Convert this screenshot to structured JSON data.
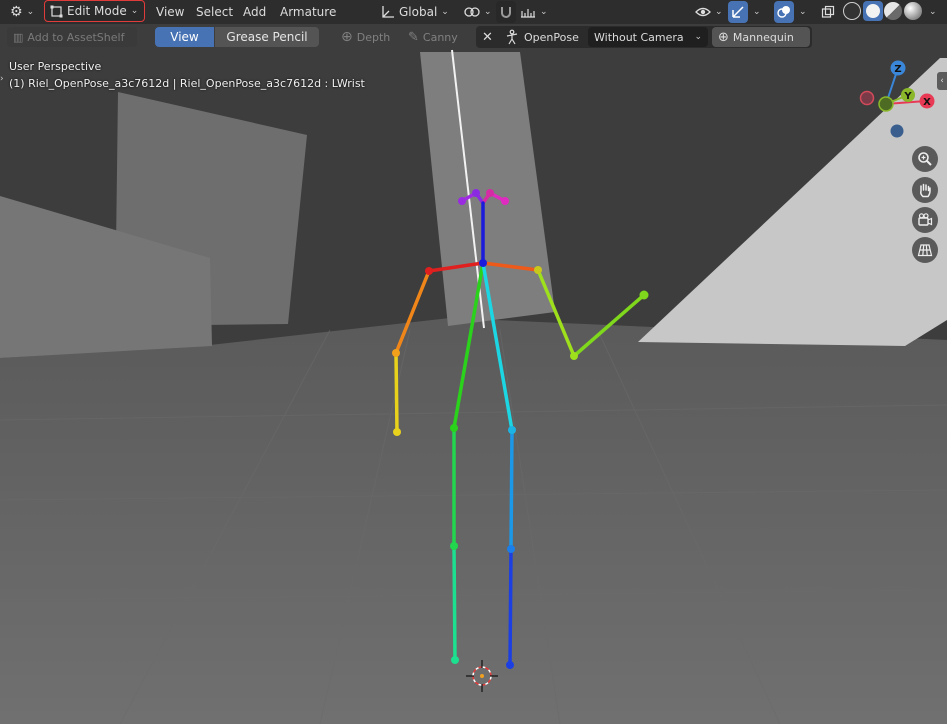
{
  "header": {
    "mode_label": "Edit Mode",
    "menus": [
      "View",
      "Select",
      "Add",
      "Armature"
    ],
    "transform_orientation": "Global"
  },
  "toolbar2": {
    "add_to_assetshelf": "Add to AssetShelf",
    "view_tab": "View",
    "grease_pencil_tab": "Grease Pencil",
    "depth_label": "Depth",
    "canny_label": "Canny",
    "openpose_label": "OpenPose",
    "camera_select": "Without Camera",
    "mannequin_label": "Mannequin"
  },
  "viewport": {
    "perspective_label": "User Perspective",
    "object_info": "(1) Riel_OpenPose_a3c7612d | Riel_OpenPose_a3c7612d : LWrist",
    "gizmo": {
      "x": "X",
      "y": "Y",
      "z": "Z"
    }
  },
  "colors": {
    "accent": "#4772b3",
    "highlight_border": "#e23b3b",
    "axis_x": "#e83a55",
    "axis_y": "#8ab82a",
    "axis_z": "#3a86d8"
  }
}
